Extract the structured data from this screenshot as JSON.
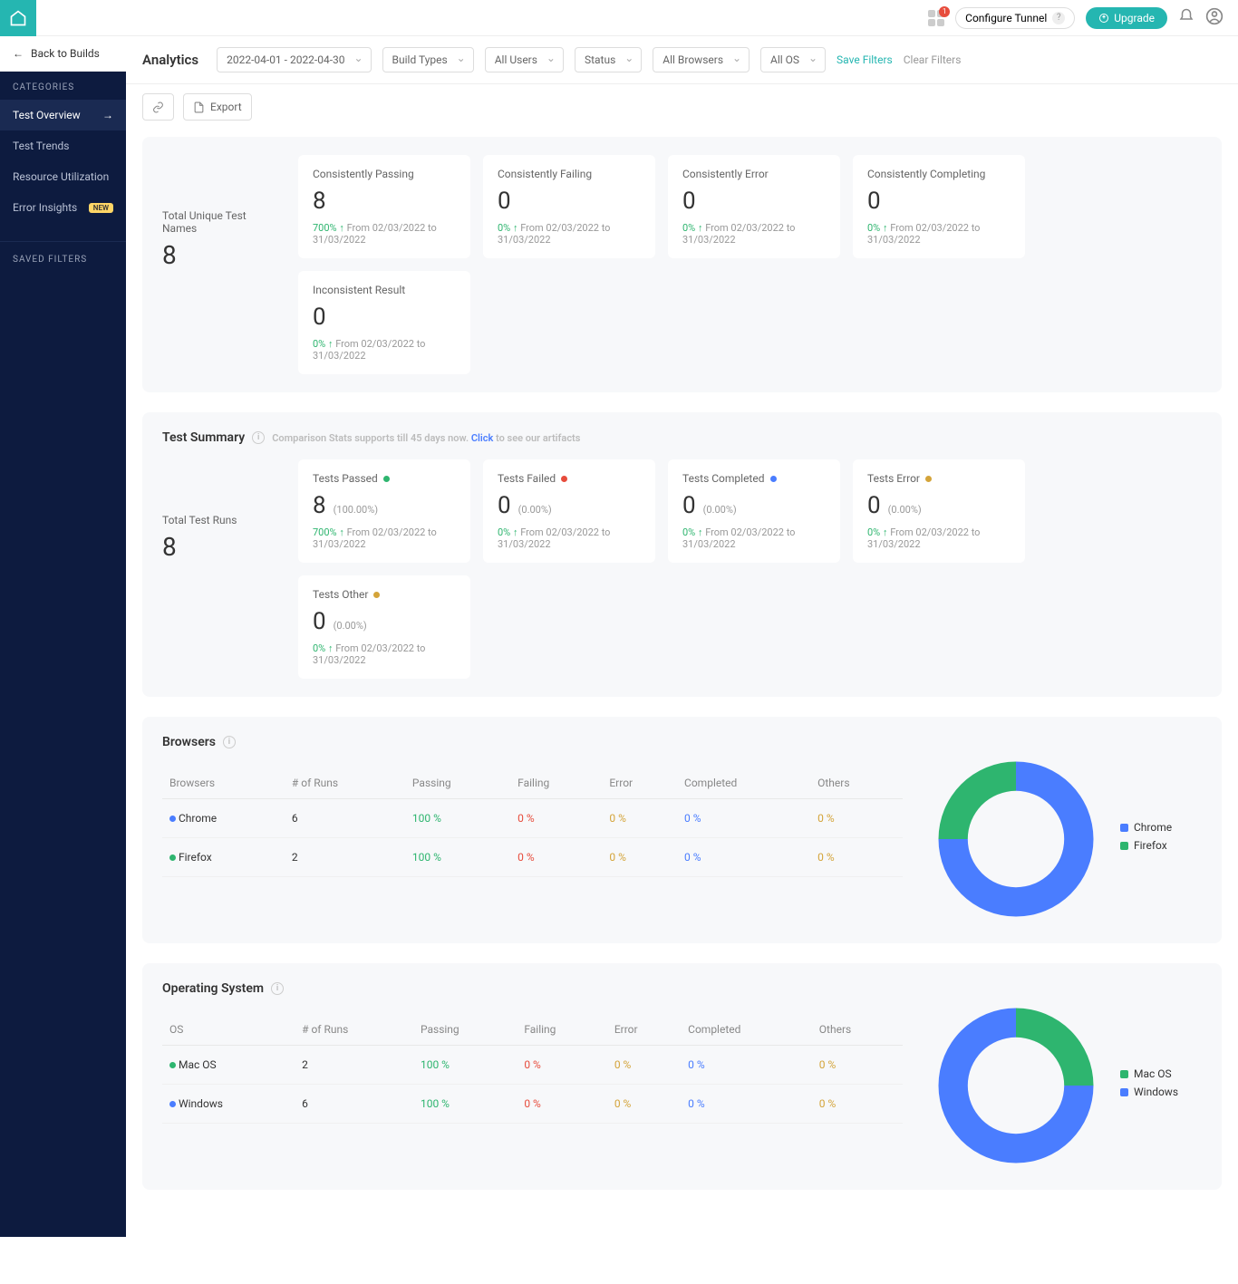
{
  "topbar": {
    "apps_badge": "1",
    "configure_tunnel": "Configure Tunnel",
    "upgrade": "Upgrade"
  },
  "sidebar": {
    "back": "Back to Builds",
    "categories_head": "CATEGORIES",
    "items": [
      "Test Overview",
      "Test Trends",
      "Resource Utilization",
      "Error Insights"
    ],
    "new_badge": "NEW",
    "saved_filters_head": "SAVED FILTERS"
  },
  "toolbar": {
    "title": "Analytics",
    "date_range": "2022-04-01 - 2022-04-30",
    "build_types": "Build Types",
    "all_users": "All Users",
    "status": "Status",
    "all_browsers": "All Browsers",
    "all_os": "All OS",
    "save_filters": "Save Filters",
    "clear_filters": "Clear Filters",
    "export": "Export"
  },
  "unique": {
    "left_label": "Total Unique Test Names",
    "left_value": "8",
    "cards": [
      {
        "title": "Consistently Passing",
        "value": "8",
        "pct": "700%",
        "range": "From 02/03/2022 to 31/03/2022"
      },
      {
        "title": "Consistently Failing",
        "value": "0",
        "pct": "0%",
        "range": "From 02/03/2022 to 31/03/2022"
      },
      {
        "title": "Consistently Error",
        "value": "0",
        "pct": "0%",
        "range": "From 02/03/2022 to 31/03/2022"
      },
      {
        "title": "Consistently Completing",
        "value": "0",
        "pct": "0%",
        "range": "From 02/03/2022 to 31/03/2022"
      },
      {
        "title": "Inconsistent Result",
        "value": "0",
        "pct": "0%",
        "range": "From 02/03/2022 to 31/03/2022"
      }
    ]
  },
  "summary": {
    "title": "Test Summary",
    "hint_pre": "Comparison Stats supports till 45 days now.",
    "hint_click": "Click",
    "hint_post": "to see our artifacts",
    "left_label": "Total Test Runs",
    "left_value": "8",
    "cards": [
      {
        "title": "Tests Passed",
        "dot": "#2eb56f",
        "value": "8",
        "pct_small": "(100.00%)",
        "pct": "700%",
        "range": "From 02/03/2022 to 31/03/2022"
      },
      {
        "title": "Tests Failed",
        "dot": "#e74c3c",
        "value": "0",
        "pct_small": "(0.00%)",
        "pct": "0%",
        "range": "From 02/03/2022 to 31/03/2022"
      },
      {
        "title": "Tests Completed",
        "dot": "#4a7dff",
        "value": "0",
        "pct_small": "(0.00%)",
        "pct": "0%",
        "range": "From 02/03/2022 to 31/03/2022"
      },
      {
        "title": "Tests Error",
        "dot": "#d4a43a",
        "value": "0",
        "pct_small": "(0.00%)",
        "pct": "0%",
        "range": "From 02/03/2022 to 31/03/2022"
      },
      {
        "title": "Tests Other",
        "dot": "#d4a43a",
        "value": "0",
        "pct_small": "(0.00%)",
        "pct": "0%",
        "range": "From 02/03/2022 to 31/03/2022"
      }
    ]
  },
  "browsers": {
    "title": "Browsers",
    "cols": [
      "Browsers",
      "# of Runs",
      "Passing",
      "Failing",
      "Error",
      "Completed",
      "Others"
    ],
    "rows": [
      {
        "name": "Chrome",
        "dot": "#4a7dff",
        "runs": "6",
        "passing": "100 %",
        "failing": "0 %",
        "error": "0 %",
        "completed": "0 %",
        "others": "0 %"
      },
      {
        "name": "Firefox",
        "dot": "#2eb56f",
        "runs": "2",
        "passing": "100 %",
        "failing": "0 %",
        "error": "0 %",
        "completed": "0 %",
        "others": "0 %"
      }
    ],
    "legend": [
      {
        "name": "Chrome",
        "color": "#4a7dff"
      },
      {
        "name": "Firefox",
        "color": "#2eb56f"
      }
    ]
  },
  "os": {
    "title": "Operating System",
    "cols": [
      "OS",
      "# of Runs",
      "Passing",
      "Failing",
      "Error",
      "Completed",
      "Others"
    ],
    "rows": [
      {
        "name": "Mac OS",
        "dot": "#2eb56f",
        "runs": "2",
        "passing": "100 %",
        "failing": "0 %",
        "error": "0 %",
        "completed": "0 %",
        "others": "0 %"
      },
      {
        "name": "Windows",
        "dot": "#4a7dff",
        "runs": "6",
        "passing": "100 %",
        "failing": "0 %",
        "error": "0 %",
        "completed": "0 %",
        "others": "0 %"
      }
    ],
    "legend": [
      {
        "name": "Mac OS",
        "color": "#2eb56f"
      },
      {
        "name": "Windows",
        "color": "#4a7dff"
      }
    ]
  },
  "chart_data": [
    {
      "type": "pie",
      "title": "Browsers",
      "series": [
        {
          "name": "Chrome",
          "value": 6,
          "color": "#4a7dff"
        },
        {
          "name": "Firefox",
          "value": 2,
          "color": "#2eb56f"
        }
      ]
    },
    {
      "type": "pie",
      "title": "Operating System",
      "series": [
        {
          "name": "Mac OS",
          "value": 2,
          "color": "#2eb56f"
        },
        {
          "name": "Windows",
          "value": 6,
          "color": "#4a7dff"
        }
      ]
    }
  ]
}
